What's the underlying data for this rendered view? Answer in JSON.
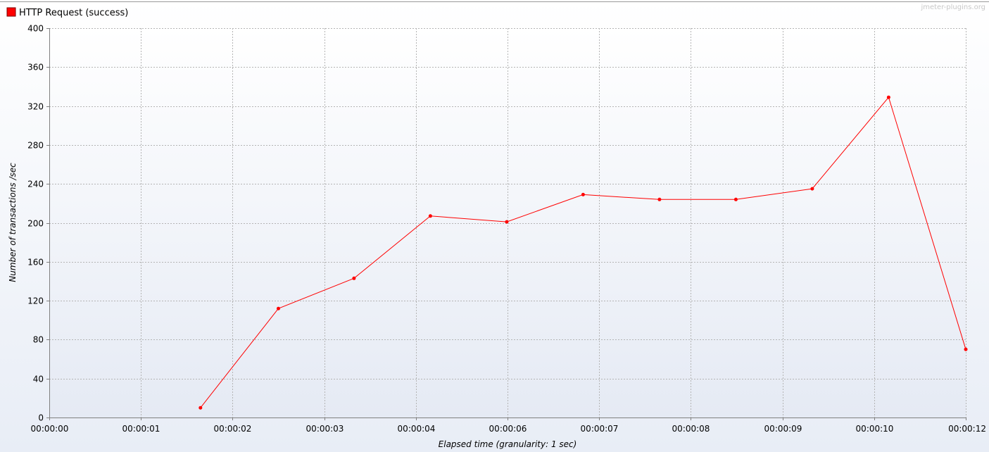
{
  "chart_data": {
    "type": "line",
    "watermark": "jmeter-plugins.org",
    "xlabel": "Elapsed time (granularity: 1 sec)",
    "ylabel": "Number of transactions /sec",
    "ylim": [
      0,
      400
    ],
    "yticks": [
      0,
      40,
      80,
      120,
      160,
      200,
      240,
      280,
      320,
      360,
      400
    ],
    "xlim_seconds": [
      0,
      12
    ],
    "xticks": [
      {
        "label": "00:00:00",
        "t": 0
      },
      {
        "label": "00:00:01",
        "t": 1.2
      },
      {
        "label": "00:00:02",
        "t": 2.4
      },
      {
        "label": "00:00:03",
        "t": 3.6
      },
      {
        "label": "00:00:04",
        "t": 4.8
      },
      {
        "label": "00:00:06",
        "t": 6.0
      },
      {
        "label": "00:00:07",
        "t": 7.2
      },
      {
        "label": "00:00:08",
        "t": 8.4
      },
      {
        "label": "00:00:09",
        "t": 9.6
      },
      {
        "label": "00:00:10",
        "t": 10.8
      },
      {
        "label": "00:00:12",
        "t": 12.0
      }
    ],
    "grid": true,
    "legend_position": "top-left",
    "series": [
      {
        "name": "HTTP Request (success)",
        "color": "#ff0000",
        "points": [
          {
            "t": 1.98,
            "y": 10
          },
          {
            "t": 3.0,
            "y": 112
          },
          {
            "t": 3.99,
            "y": 143
          },
          {
            "t": 4.99,
            "y": 207
          },
          {
            "t": 5.99,
            "y": 201
          },
          {
            "t": 6.99,
            "y": 229
          },
          {
            "t": 7.99,
            "y": 224
          },
          {
            "t": 8.99,
            "y": 224
          },
          {
            "t": 9.99,
            "y": 235
          },
          {
            "t": 10.99,
            "y": 329
          },
          {
            "t": 12.0,
            "y": 70
          }
        ]
      }
    ]
  }
}
